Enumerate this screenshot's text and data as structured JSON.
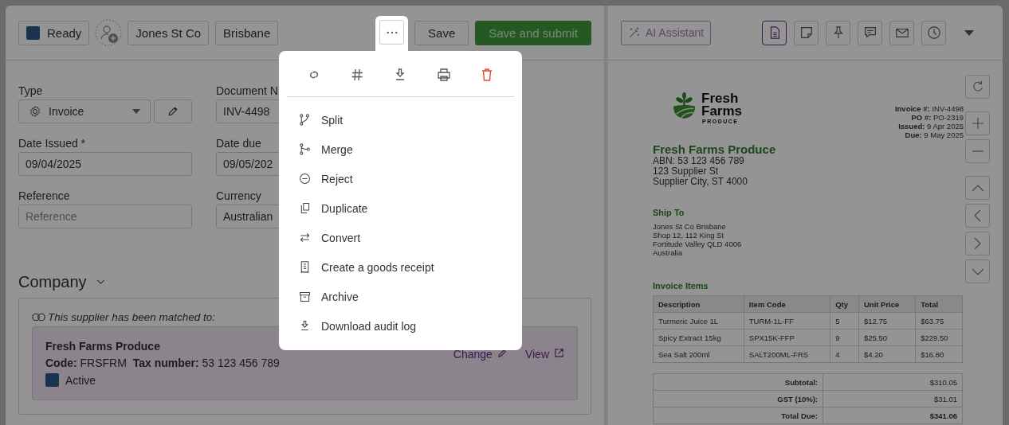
{
  "header": {
    "status": {
      "label": "Ready"
    },
    "tags": [
      "Jones St Co",
      "Brisbane"
    ],
    "buttons": [
      {
        "label": "Save",
        "kind": "secondary"
      },
      {
        "label": "Save and submit",
        "kind": "primary"
      }
    ]
  },
  "actions_menu": {
    "items": [
      {
        "label": "Split"
      },
      {
        "label": "Merge"
      },
      {
        "label": "Reject"
      },
      {
        "label": "Duplicate"
      },
      {
        "label": "Convert"
      },
      {
        "label": "Create a goods receipt"
      },
      {
        "label": "Archive"
      },
      {
        "label": "Download audit log"
      }
    ]
  },
  "form": {
    "rows": [
      [
        {
          "label": "Type",
          "value": "Invoice",
          "kind": "select"
        },
        {
          "label": "Document N",
          "value": "INV-4498",
          "kind": "text"
        }
      ],
      [
        {
          "label": "Date Issued *",
          "value": "09/04/2025",
          "kind": "text"
        },
        {
          "label": "Date due",
          "value": "09/05/202",
          "kind": "text"
        }
      ],
      [
        {
          "label": "Reference",
          "placeholder": "Reference",
          "kind": "text"
        },
        {
          "label": "Currency",
          "value": "Australian",
          "kind": "text"
        }
      ]
    ]
  },
  "company": {
    "title": "Company",
    "expanded": true,
    "match_note": "This supplier has been matched to:",
    "supplier": {
      "name": "Fresh Farms Produce",
      "code_label": "Code:",
      "code": "FRSFRM",
      "tax_label": "Tax number:",
      "tax": "53 123 456 789",
      "status": {
        "label": "Active"
      }
    },
    "links": [
      "Change",
      "View"
    ]
  },
  "right_header": {
    "ai_button": "AI Assistant",
    "view_tabs": [
      {
        "selected": true
      },
      {
        "selected": false
      },
      {
        "selected": false
      },
      {
        "selected": false
      },
      {
        "selected": false
      },
      {
        "selected": false
      }
    ]
  },
  "document": {
    "logo": {
      "line1": "Fresh",
      "line2": "Farms",
      "tagline": "PRODUCE"
    },
    "meta": [
      {
        "label": "Invoice #:",
        "value": "INV-4498"
      },
      {
        "label": "PO #:",
        "value": "PO-2319"
      },
      {
        "label": "Issued:",
        "value": "9 Apr 2025"
      },
      {
        "label": "Due:",
        "value": "9 May 2025"
      }
    ],
    "supplier_name": "Fresh Farms Produce",
    "supplier_lines": [
      "ABN: 53 123 456 789",
      "123 Supplier St",
      "Supplier City, ST 4000"
    ],
    "ship_to_title": "Ship To",
    "ship_to_lines": [
      "Jones St Co Brisbane",
      "Shop 12, 112 King St",
      "Fortitude Valley QLD 4006",
      "Australia"
    ],
    "items_title": "Invoice Items",
    "columns": [
      "Description",
      "Item Code",
      "Qty",
      "Unit Price",
      "Total"
    ],
    "rows": [
      [
        "Turmeric Juice 1L",
        "TURM-1L-FF",
        "5",
        "$12.75",
        "$63.75"
      ],
      [
        "Spicy Extract 15kg",
        "SPX15K-FFP",
        "9",
        "$25.50",
        "$229.50"
      ],
      [
        "Sea Salt 200ml",
        "SALT200ML-FRS",
        "4",
        "$4.20",
        "$16.80"
      ]
    ],
    "totals": [
      {
        "label": "Subtotal:",
        "value": "$310.05",
        "emphasis": false
      },
      {
        "label": "GST (10%):",
        "value": "$31.01",
        "emphasis": false
      },
      {
        "label": "Total Due:",
        "value": "$341.06",
        "emphasis": true
      }
    ]
  }
}
